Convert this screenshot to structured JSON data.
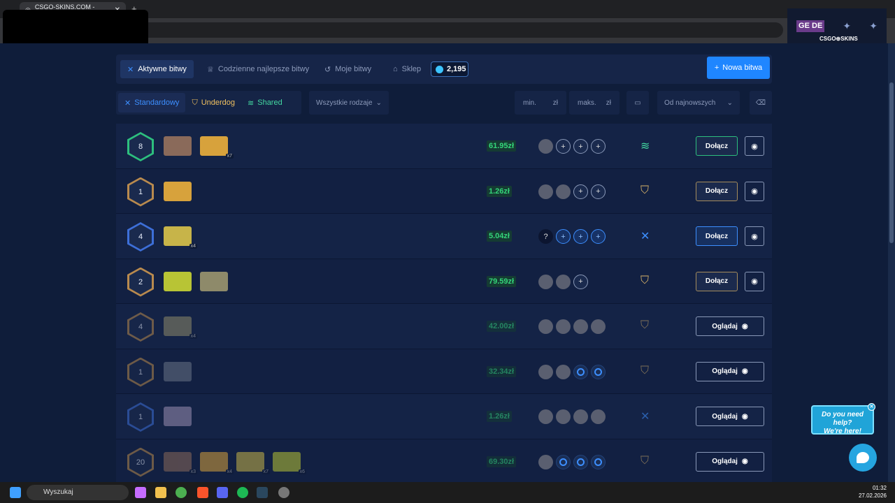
{
  "browser": {
    "tab_title": "CSGO-SKINS.COM - Najlepsze",
    "url_suffix": "e",
    "brand_overlay": "CSGO⊕SKINS",
    "brand_badge": "GE DE"
  },
  "nav": {
    "active_battles": "Aktywne bitwy",
    "daily_best": "Codzienne najlepsze bitwy",
    "my_battles": "Moje bitwy",
    "shop": "Sklep",
    "balance": "2,195",
    "new_battle": "Nowa bitwa"
  },
  "filters": {
    "standard": "Standardowy",
    "underdog": "Underdog",
    "shared": "Shared",
    "type_select": "Wszystkie rodzaje",
    "min_placeholder": "min.",
    "max_placeholder": "maks.",
    "currency": "zł",
    "sort_select": "Od najnowszych"
  },
  "battles": [
    {
      "round": "8",
      "price": "61.95zł",
      "mode": "shared",
      "action": "Dołącz",
      "cases": [
        {
          "mul": ""
        },
        {
          "mul": "x7"
        }
      ],
      "players": [
        "av",
        "add",
        "add",
        "add"
      ]
    },
    {
      "round": "1",
      "price": "1.26zł",
      "mode": "underdog",
      "action": "Dołącz",
      "cases": [
        {
          "mul": ""
        }
      ],
      "players": [
        "av",
        "av",
        "add",
        "add"
      ]
    },
    {
      "round": "4",
      "price": "5.04zł",
      "mode": "standard",
      "action": "Dołącz",
      "cases": [
        {
          "mul": "x4"
        }
      ],
      "players": [
        "q",
        "addb",
        "addb",
        "addb"
      ]
    },
    {
      "round": "2",
      "price": "79.59zł",
      "mode": "underdog",
      "action": "Dołącz",
      "cases": [
        {
          "mul": ""
        },
        {
          "mul": ""
        }
      ],
      "players": [
        "av",
        "av",
        "add"
      ]
    },
    {
      "round": "4",
      "price": "42.00zł",
      "mode": "underdog",
      "action": "Oglądaj",
      "cases": [
        {
          "mul": "x4"
        }
      ],
      "players": [
        "av",
        "av",
        "av",
        "av"
      ]
    },
    {
      "round": "1",
      "price": "32.34zł",
      "mode": "underdog",
      "action": "Oglądaj",
      "cases": [
        {
          "mul": ""
        }
      ],
      "players": [
        "av",
        "av",
        "slot",
        "slot"
      ]
    },
    {
      "round": "1",
      "price": "1.26zł",
      "mode": "standard",
      "action": "Oglądaj",
      "cases": [
        {
          "mul": ""
        }
      ],
      "players": [
        "av",
        "av",
        "av",
        "av"
      ]
    },
    {
      "round": "20",
      "price": "69.30zł",
      "mode": "underdog",
      "action": "Oglądaj",
      "cases": [
        {
          "mul": "x3"
        },
        {
          "mul": "x4"
        },
        {
          "mul": "x7"
        },
        {
          "mul": "x6"
        }
      ],
      "players": [
        "av",
        "slot",
        "slot",
        "slot"
      ]
    }
  ],
  "help": {
    "line1": "Do you need help?",
    "line2": "We're here!"
  },
  "taskbar": {
    "search": "Wyszukaj",
    "time": "01:32",
    "date": "27.02.2026"
  }
}
